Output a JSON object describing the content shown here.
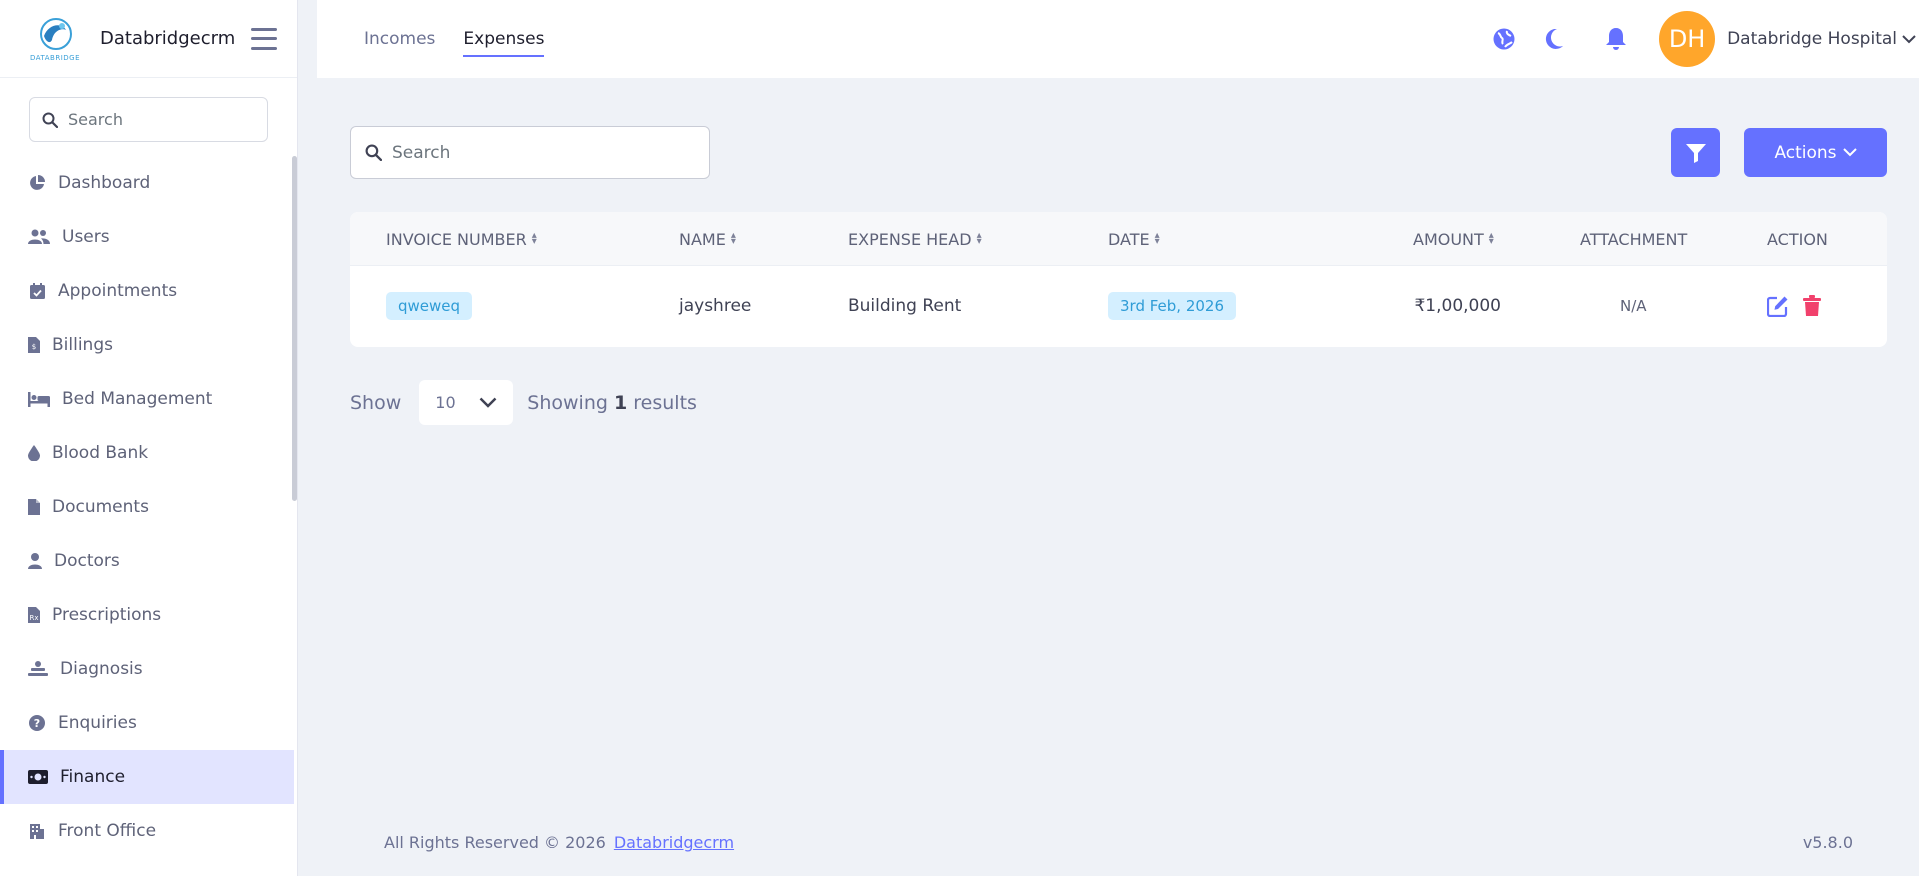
{
  "sidebar": {
    "brand_name": "Databridgecrm",
    "logo_text": "DATABRIDGE",
    "search_placeholder": "Search",
    "items": [
      {
        "label": "Dashboard",
        "icon": "chart-pie-icon"
      },
      {
        "label": "Users",
        "icon": "users-icon"
      },
      {
        "label": "Appointments",
        "icon": "calendar-check-icon"
      },
      {
        "label": "Billings",
        "icon": "file-invoice-icon"
      },
      {
        "label": "Bed Management",
        "icon": "bed-icon"
      },
      {
        "label": "Blood Bank",
        "icon": "droplet-icon"
      },
      {
        "label": "Documents",
        "icon": "file-icon"
      },
      {
        "label": "Doctors",
        "icon": "doctor-icon"
      },
      {
        "label": "Prescriptions",
        "icon": "prescription-icon"
      },
      {
        "label": "Diagnosis",
        "icon": "diagnosis-icon"
      },
      {
        "label": "Enquiries",
        "icon": "question-circle-icon"
      },
      {
        "label": "Finance",
        "icon": "money-bill-icon",
        "active": true
      },
      {
        "label": "Front Office",
        "icon": "building-icon"
      }
    ]
  },
  "header": {
    "tabs": [
      {
        "label": "Incomes",
        "active": false
      },
      {
        "label": "Expenses",
        "active": true
      }
    ],
    "avatar_initials": "DH",
    "user_name": "Databridge Hospital"
  },
  "content": {
    "search_placeholder": "Search",
    "actions_label": "Actions",
    "table": {
      "columns": [
        "INVOICE NUMBER",
        "NAME",
        "EXPENSE HEAD",
        "DATE",
        "AMOUNT",
        "ATTACHMENT",
        "ACTION"
      ],
      "rows": [
        {
          "invoice_number": "qweweq",
          "name": "jayshree",
          "expense_head": "Building Rent",
          "date": "3rd Feb, 2026",
          "amount": "₹1,00,000",
          "attachment": "N/A"
        }
      ]
    },
    "pagination": {
      "show_label": "Show",
      "page_size": "10",
      "showing_prefix": "Showing",
      "result_count": "1",
      "showing_suffix": "results"
    }
  },
  "footer": {
    "copyright": "All Rights Reserved © 2026",
    "brand_link": "Databridgecrm",
    "version": "v5.8.0"
  },
  "colors": {
    "primary": "#6571ff",
    "avatar": "#ffa62b",
    "danger": "#f1416c",
    "pill_bg": "#d4efff",
    "pill_text": "#2f9cd6"
  }
}
